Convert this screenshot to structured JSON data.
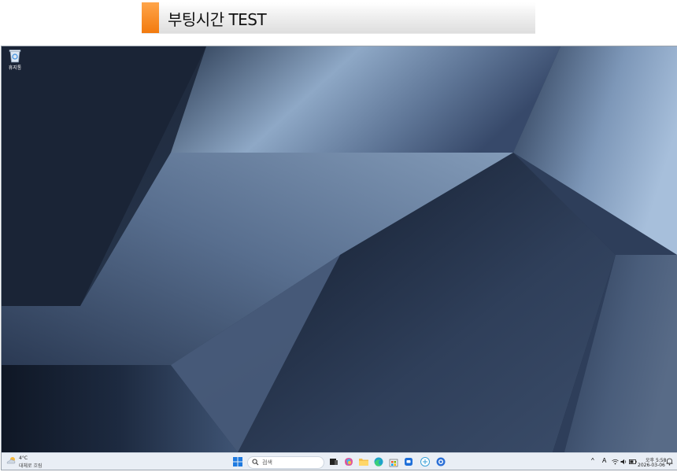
{
  "banner": {
    "title": "부팅시간 TEST",
    "accent_color": "#f27a0e"
  },
  "desktop": {
    "icons": [
      {
        "label": "휴지통",
        "icon": "recycle-bin-icon"
      }
    ]
  },
  "taskbar": {
    "weather": {
      "temp": "4°C",
      "desc": "대체로 흐림",
      "icon": "cloud-sun-icon"
    },
    "search": {
      "placeholder": "검색"
    },
    "pinned": [
      {
        "name": "start",
        "icon": "windows-logo-icon"
      },
      {
        "name": "task-view",
        "icon": "task-view-icon"
      },
      {
        "name": "copilot",
        "icon": "copilot-icon"
      },
      {
        "name": "file-explorer",
        "icon": "folder-icon"
      },
      {
        "name": "edge",
        "icon": "edge-icon"
      },
      {
        "name": "store",
        "icon": "store-icon"
      },
      {
        "name": "app-blue",
        "icon": "chat-app-icon"
      },
      {
        "name": "app-share",
        "icon": "share-app-icon"
      },
      {
        "name": "app-circle",
        "icon": "circle-app-icon"
      }
    ],
    "tray": {
      "chevron": "^",
      "ime": "A",
      "time": "오후 5:58",
      "date": "2026-03-06"
    }
  }
}
